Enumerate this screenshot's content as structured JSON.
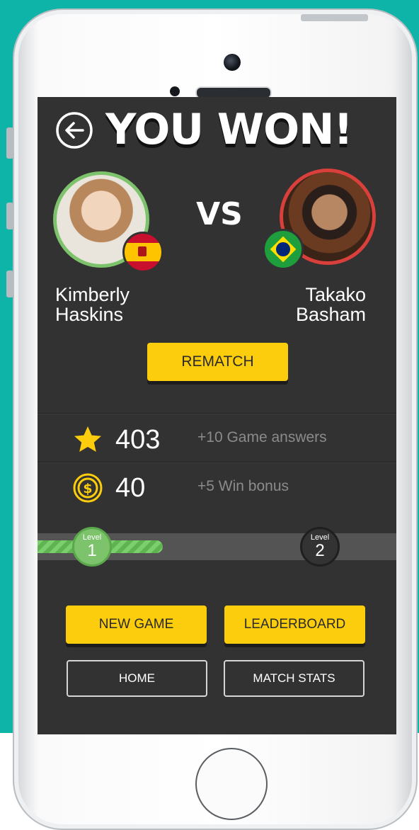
{
  "header": {
    "title": "YOU WON!"
  },
  "match": {
    "vs_label": "VS",
    "player1": {
      "first_name": "Kimberly",
      "last_name": "Haskins"
    },
    "player2": {
      "first_name": "Takako",
      "last_name": "Basham"
    }
  },
  "actions": {
    "rematch_label": "REMATCH",
    "new_game_label": "NEW GAME",
    "leaderboard_label": "LEADERBOARD",
    "home_label": "HOME",
    "match_stats_label": "MATCH STATS"
  },
  "stats": {
    "points": {
      "value": "403",
      "description": "+10 Game answers",
      "icon": "star-icon"
    },
    "coins": {
      "value": "40",
      "description": "+5 Win bonus",
      "icon": "coin-icon"
    }
  },
  "level": {
    "current_label": "Level",
    "current_number": "1",
    "next_label": "Level",
    "next_number": "2",
    "progress_fraction": 0.35
  },
  "colors": {
    "accent": "#fccd0c",
    "screen_bg": "#323232",
    "winner_ring": "#7cc36b",
    "opponent_ring": "#d9403b",
    "background": "#0fb4a8"
  }
}
